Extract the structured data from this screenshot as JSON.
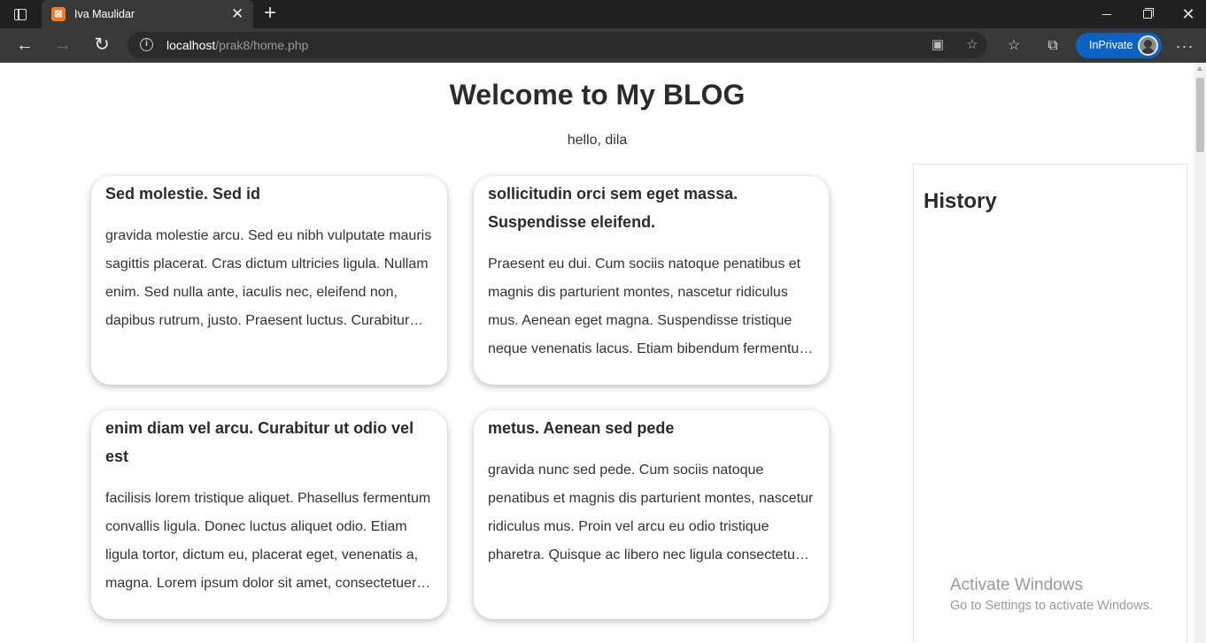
{
  "browser": {
    "tab_title": "Iva Maulidar",
    "favicon_letter": "⊠",
    "url_host": "localhost",
    "url_path": "/prak8/home.php",
    "inprivate_label": "InPrivate",
    "accent_color": "#0a62c4",
    "favicon_color": "#f47c20"
  },
  "page": {
    "title": "Welcome to My BLOG",
    "greeting": "hello, dila"
  },
  "posts": [
    {
      "title": "Sed molestie. Sed id",
      "body": "gravida molestie arcu. Sed eu nibh vulputate mauris sagittis placerat. Cras dictum ultricies ligula. Nullam enim. Sed nulla ante, iaculis nec, eleifend non, dapibus rutrum, justo. Praesent luctus. Curabitur…"
    },
    {
      "title": "sollicitudin orci sem eget massa. Suspendisse eleifend.",
      "body": "Praesent eu dui. Cum sociis natoque penatibus et magnis dis parturient montes, nascetur ridiculus mus. Aenean eget magna. Suspendisse tristique neque venenatis lacus. Etiam bibendum fermentu…"
    },
    {
      "title": "enim diam vel arcu. Curabitur ut odio vel est",
      "body": "facilisis lorem tristique aliquet. Phasellus fermentum convallis ligula. Donec luctus aliquet odio. Etiam ligula tortor, dictum eu, placerat eget, venenatis a, magna. Lorem ipsum dolor sit amet, consectetuer…"
    },
    {
      "title": "metus. Aenean sed pede",
      "body": "gravida nunc sed pede. Cum sociis natoque penatibus et magnis dis parturient montes, nascetur ridiculus mus. Proin vel arcu eu odio tristique pharetra. Quisque ac libero nec ligula consectetu…"
    }
  ],
  "sidebar": {
    "title": "History"
  },
  "watermark": {
    "title": "Activate Windows",
    "subtitle": "Go to Settings to activate Windows."
  }
}
